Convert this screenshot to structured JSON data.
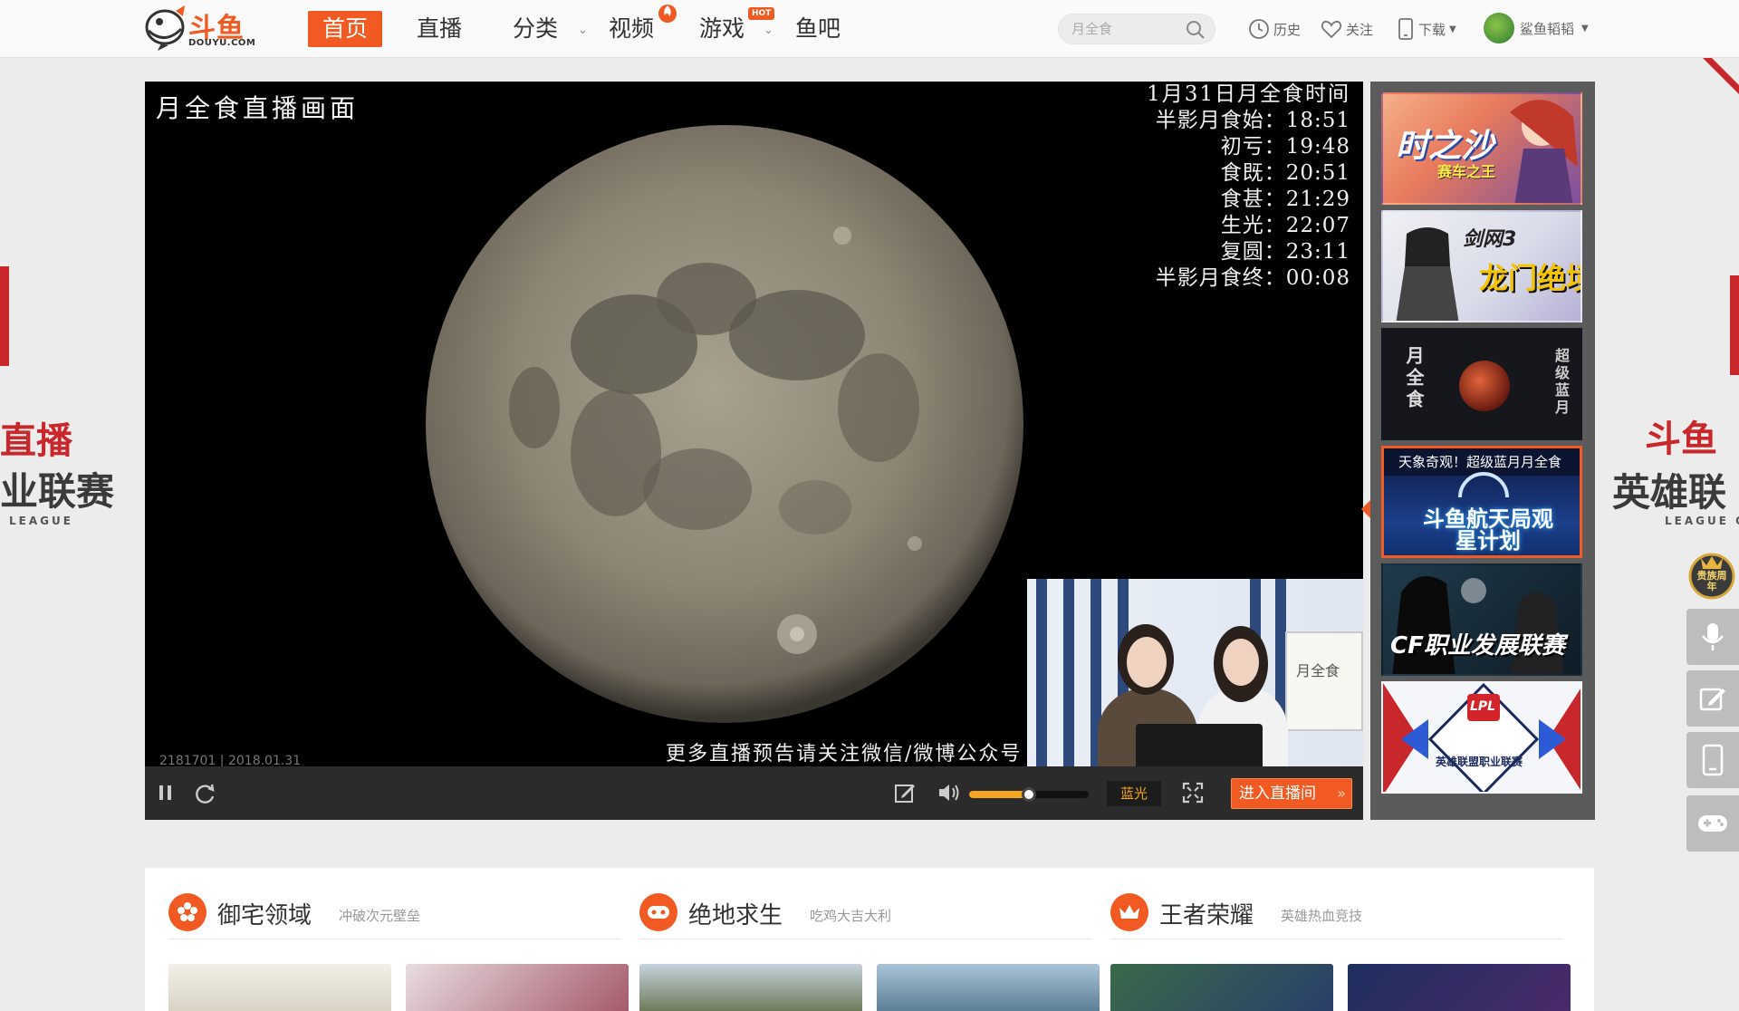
{
  "header": {
    "logo": {
      "name": "斗鱼",
      "sub": "DOUYU.COM"
    },
    "nav": [
      {
        "label": "首页",
        "active": true
      },
      {
        "label": "直播"
      },
      {
        "label": "分类",
        "has_dropdown": true
      },
      {
        "label": "视频",
        "badge_icon": "fire-icon"
      },
      {
        "label": "游戏",
        "badge": "HOT",
        "has_dropdown": true
      },
      {
        "label": "鱼吧"
      }
    ],
    "search": {
      "value": "",
      "placeholder": "月全食"
    },
    "tools": {
      "history": "历史",
      "follow": "关注",
      "download": "下载",
      "username": "鲨鱼韬韬"
    }
  },
  "side_banner": {
    "left": {
      "line1": "直播",
      "line2": "业联赛",
      "line3": "LEAGUE"
    },
    "right": {
      "line1": "斗鱼",
      "line2": "英雄联",
      "line3": "LEAGUE O"
    }
  },
  "player": {
    "overlay_title": "月全食直播画面",
    "schedule": {
      "title": "1月31日月全食时间",
      "rows": [
        {
          "label": "半影月食始：",
          "time": "18:51"
        },
        {
          "label": "初亏：",
          "time": "19:48"
        },
        {
          "label": "食既：",
          "time": "20:51"
        },
        {
          "label": "食甚：",
          "time": "21:29"
        },
        {
          "label": "生光：",
          "time": "22:07"
        },
        {
          "label": "复圆：",
          "time": "23:11"
        },
        {
          "label": "半影月食终：",
          "time": "00:08"
        }
      ]
    },
    "bottom_caption": "更多直播预告请关注微信/微博公众号",
    "stamp": "2181701 | 2018.01.31",
    "pip_board_text": "月全食",
    "controls": {
      "quality_label": "蓝光",
      "enter_room_label": "进入直播间",
      "volume": 0.5
    }
  },
  "rail": {
    "items": [
      {
        "title": "时之沙",
        "subtitle": "赛车之王",
        "active": false
      },
      {
        "title": "剑网3",
        "subtitle": "龙门绝境",
        "active": false
      },
      {
        "title": "月全食",
        "subtitle": "超级蓝月",
        "active": false
      },
      {
        "title": "天象奇观！超级蓝月月全食",
        "subtitle": "斗鱼航天局观星计划",
        "active": true
      },
      {
        "title": "CF职业发展联赛",
        "subtitle": "",
        "active": false
      },
      {
        "title": "LPL",
        "subtitle": "英雄联盟职业联赛",
        "active": false
      }
    ]
  },
  "float_tools": {
    "badge": "贵族周年",
    "items": [
      "mic-icon",
      "edit-icon",
      "phone-icon",
      "gamepad-icon"
    ]
  },
  "categories": [
    {
      "name": "御宅领域",
      "sub": "冲破次元壁垒",
      "icon": "flower-icon"
    },
    {
      "name": "绝地求生",
      "sub": "吃鸡大吉大利",
      "icon": "gamepad-icon"
    },
    {
      "name": "王者荣耀",
      "sub": "英雄热血竞技",
      "icon": "crown-icon"
    }
  ],
  "colors": {
    "brand": "#f15a22",
    "player_bg": "#000000",
    "rail_bg": "#5b5b5b",
    "accent_volume": "#f5a623"
  }
}
